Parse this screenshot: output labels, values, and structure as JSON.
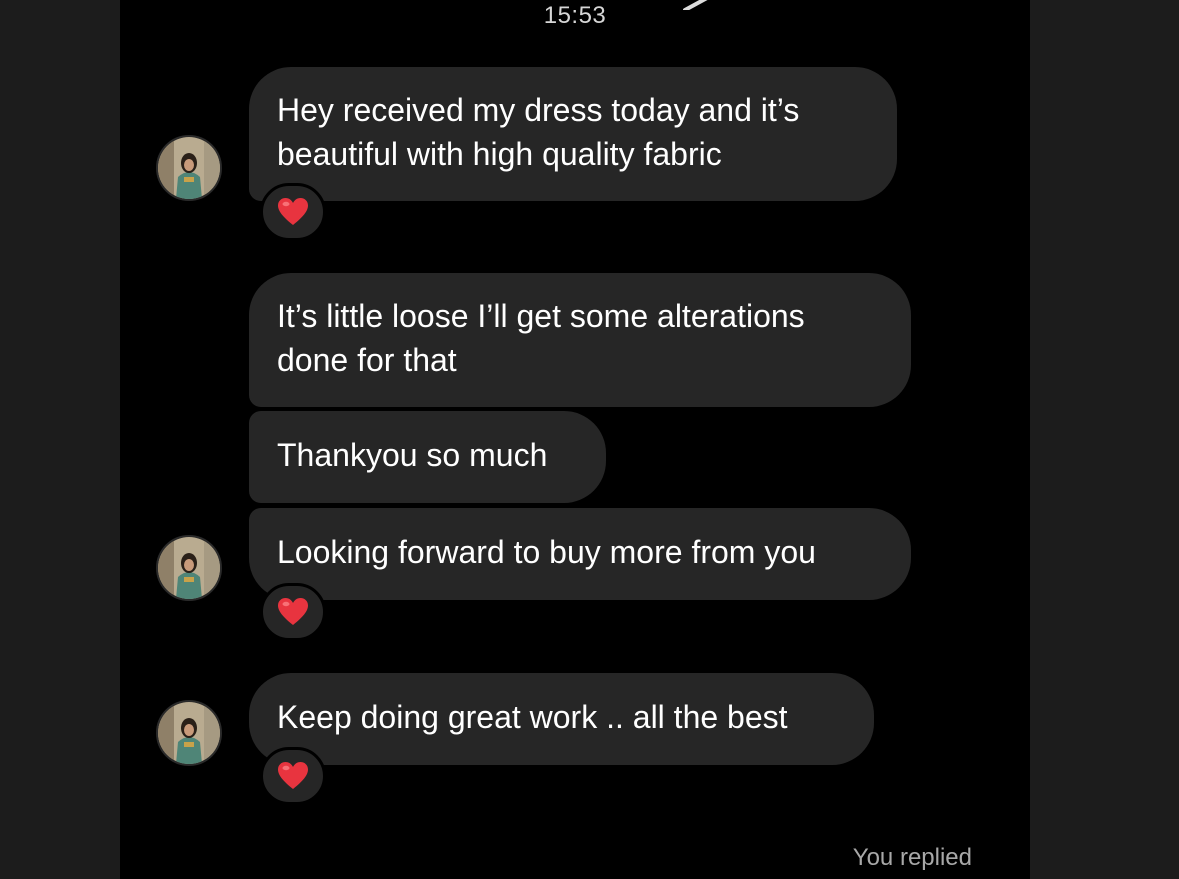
{
  "header": {
    "timestamp": "15:53"
  },
  "messages": [
    {
      "text": "Hey received my dress today and it’s beautiful with high quality fabric",
      "reaction": "heart-icon"
    },
    {
      "text": "It’s little loose I’ll get some alterations done for that"
    },
    {
      "text": "Thankyou so much"
    },
    {
      "text": "Looking forward to buy more from you",
      "reaction": "heart-icon"
    },
    {
      "text": "Keep doing great work .. all the best",
      "reaction": "heart-icon"
    }
  ],
  "footer": {
    "status": "You replied"
  },
  "colors": {
    "background": "#000000",
    "side_panel": "#1c1c1c",
    "bubble": "#262626",
    "text": "#ffffff",
    "heart": "#e8343f",
    "muted_text": "#a8a8a8"
  }
}
